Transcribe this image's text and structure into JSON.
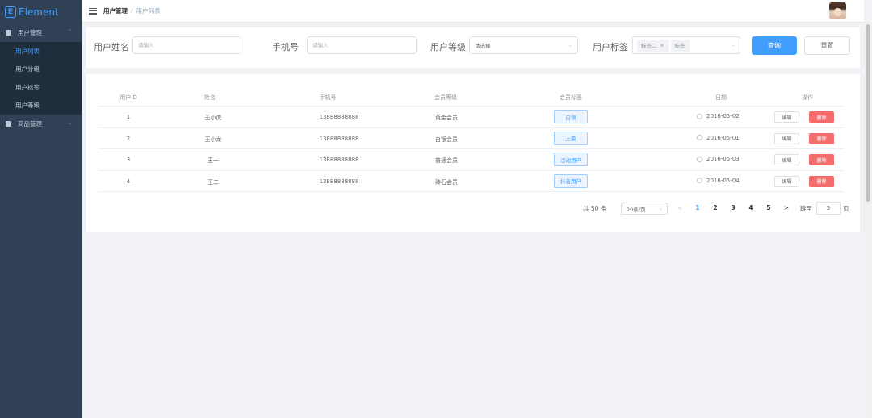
{
  "app": {
    "logo_text": "Element",
    "logo_glyph": "E"
  },
  "sidebar": {
    "groups": [
      {
        "label": "用户管理",
        "icon": "menu-square-icon",
        "expanded": true,
        "items": [
          {
            "label": "用户列表",
            "active": true
          },
          {
            "label": "用户分组",
            "active": false
          },
          {
            "label": "用户标签",
            "active": false
          },
          {
            "label": "用户等级",
            "active": false
          }
        ]
      },
      {
        "label": "商品管理",
        "icon": "menu-square-icon",
        "expanded": false,
        "items": []
      }
    ],
    "colors": {
      "bg": "#304156",
      "sub_bg": "#1f2d3d",
      "text": "#bfcbd9",
      "active": "#409eff"
    }
  },
  "header": {
    "breadcrumb": [
      "用户管理",
      "用户列表"
    ],
    "separator": "/"
  },
  "filters": {
    "name": {
      "label": "用户姓名",
      "placeholder": "请输入",
      "value": ""
    },
    "phone": {
      "label": "手机号",
      "placeholder": "请输入",
      "value": ""
    },
    "level": {
      "label": "用户等级",
      "placeholder": "请选择",
      "value": ""
    },
    "tags": {
      "label": "用户标签",
      "selected": [
        "标签二",
        "标签"
      ]
    },
    "search_label": "查询",
    "reset_label": "重置"
  },
  "table": {
    "columns": [
      "用户ID",
      "姓名",
      "手机号",
      "会员等级",
      "会员标签",
      "日期",
      "操作"
    ],
    "rows": [
      {
        "id": "1",
        "name": "王小虎",
        "phone": "13888888888",
        "level": "黄金会员",
        "tag": "白领",
        "date": "2016-05-02"
      },
      {
        "id": "2",
        "name": "王小龙",
        "phone": "13888888888",
        "level": "白银会员",
        "tag": "土豪",
        "date": "2016-05-01"
      },
      {
        "id": "3",
        "name": "王一",
        "phone": "13888888888",
        "level": "普通会员",
        "tag": "活动用户",
        "date": "2016-05-03"
      },
      {
        "id": "4",
        "name": "王二",
        "phone": "13888888888",
        "level": "砖石会员",
        "tag": "抖音用户",
        "date": "2016-05-04"
      }
    ],
    "edit_label": "编辑",
    "delete_label": "删除"
  },
  "pagination": {
    "total_text": "共 50 条",
    "page_size": "20条/页",
    "prev": "<",
    "next": ">",
    "pages": [
      "1",
      "2",
      "3",
      "4",
      "5"
    ],
    "current": "1",
    "jump_prefix": "跳至",
    "jump_value": "5",
    "jump_suffix": "页"
  },
  "theme": {
    "primary": "#409eff",
    "danger": "#f56c6c",
    "border": "#dcdfe6",
    "page_bg": "#f0f2f5"
  }
}
